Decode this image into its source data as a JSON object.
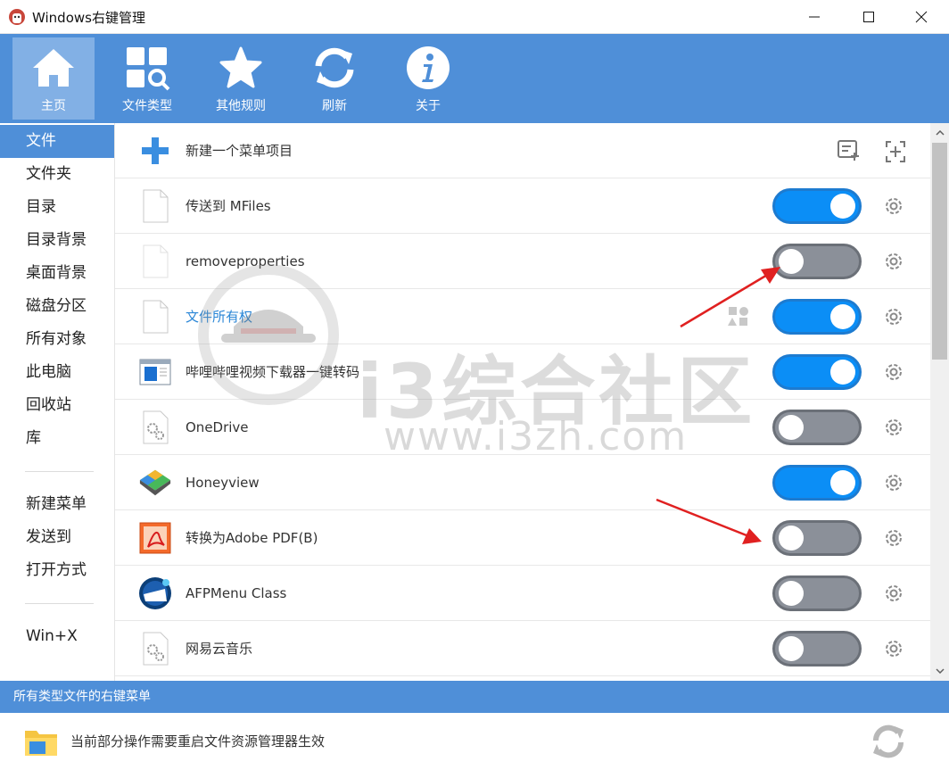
{
  "window": {
    "title": "Windows右键管理"
  },
  "toolbar": {
    "items": [
      {
        "label": "主页",
        "icon": "home-icon"
      },
      {
        "label": "文件类型",
        "icon": "file-types-search-icon"
      },
      {
        "label": "其他规则",
        "icon": "star-icon"
      },
      {
        "label": "刷新",
        "icon": "refresh-icon"
      },
      {
        "label": "关于",
        "icon": "info-icon"
      }
    ]
  },
  "sidebar": {
    "items": [
      {
        "label": "文件"
      },
      {
        "label": "文件夹"
      },
      {
        "label": "目录"
      },
      {
        "label": "目录背景"
      },
      {
        "label": "桌面背景"
      },
      {
        "label": "磁盘分区"
      },
      {
        "label": "所有对象"
      },
      {
        "label": "此电脑"
      },
      {
        "label": "回收站"
      },
      {
        "label": "库"
      },
      {
        "label": "新建菜单"
      },
      {
        "label": "发送到"
      },
      {
        "label": "打开方式"
      },
      {
        "label": "Win+X"
      }
    ]
  },
  "list": {
    "new_item": {
      "label": "新建一个菜单项目"
    },
    "rows": [
      {
        "label": "传送到 MFiles",
        "enabled": true,
        "icon": "blank-file-icon"
      },
      {
        "label": "removeproperties",
        "enabled": false,
        "icon": "blank-file-icon"
      },
      {
        "label": "文件所有权",
        "enabled": true,
        "icon": "blank-file-icon"
      },
      {
        "label": "哔哩哔哩视频下载器一键转码",
        "enabled": true,
        "icon": "app-window-icon"
      },
      {
        "label": "OneDrive",
        "enabled": false,
        "icon": "gear-file-icon"
      },
      {
        "label": "Honeyview",
        "enabled": true,
        "icon": "honeyview-icon"
      },
      {
        "label": "转换为Adobe PDF(B)",
        "enabled": false,
        "icon": "adobe-pdf-icon"
      },
      {
        "label": "AFPMenu Class",
        "enabled": false,
        "icon": "afp-icon"
      },
      {
        "label": "网易云音乐",
        "enabled": false,
        "icon": "gear-file-icon"
      }
    ]
  },
  "status": {
    "text": "所有类型文件的右键菜单"
  },
  "footer": {
    "text": "当前部分操作需要重启文件资源管理器生效"
  },
  "watermark": {
    "text": "i3综合社区",
    "url": "www.i3zh.com"
  },
  "colors": {
    "accent": "#4f8fd8",
    "toggle_on": "#0b8ef6",
    "toggle_off": "#8b9099",
    "arrow": "#e02020"
  }
}
